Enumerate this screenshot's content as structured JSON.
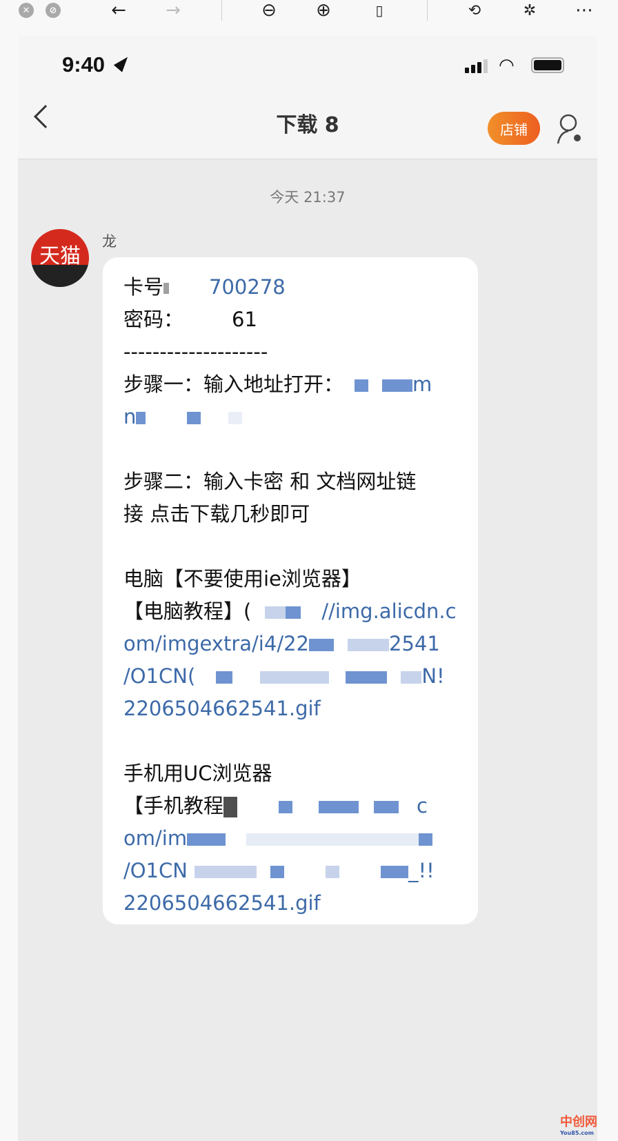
{
  "browser_toolbar": {
    "icons": [
      "close-icon",
      "block-icon",
      "back-arrow-icon",
      "forward-arrow-icon",
      "zoom-out-icon",
      "zoom-in-icon",
      "actual-size-icon",
      "rotate-icon",
      "magic-wand-icon",
      "more-icon"
    ]
  },
  "status_bar": {
    "time": "9:40"
  },
  "nav": {
    "title": "下载 8",
    "shop_button": "店铺"
  },
  "chat": {
    "timestamp": "今天 21:37",
    "sender": {
      "name": "龙",
      "avatar_text": "天猫"
    },
    "message": {
      "card_label": "卡号",
      "card_number_visible": "700278",
      "password_label": "密码：",
      "password_visible": "61",
      "divider": "--------------------",
      "step1": "步骤一：输入地址打开：",
      "step1_link_tail": "m",
      "step1_link_line2": "n",
      "step2_line1": "步骤二：输入卡密 和 文档网址链",
      "step2_line2": "接 点击下载几秒即可",
      "pc_heading": "电脑【不要使用ie浏览器】",
      "pc_tutorial_label": "【电脑教程】(",
      "pc_link_1": "//img.alicdn.c",
      "pc_link_2a": "om/imgextra/i4/22",
      "pc_link_2b": "2541",
      "pc_link_3a": "/O1CN(",
      "pc_link_3b": "N!",
      "pc_link_4": "2206504662541.gif",
      "mobile_heading": "手机用UC浏览器",
      "mobile_tutorial_label": "【手机教程",
      "mobile_link_1_tail": "c",
      "mobile_link_2": "om/im",
      "mobile_link_3a": "/O1CN",
      "mobile_link_3b": "_!!",
      "mobile_link_4": "2206504662541.gif"
    }
  },
  "watermark": {
    "name": "中创网",
    "site": "You85.com"
  },
  "colors": {
    "accent": "#ee6a22",
    "link": "#3d6aa8",
    "avatar": "#d42a1e"
  }
}
